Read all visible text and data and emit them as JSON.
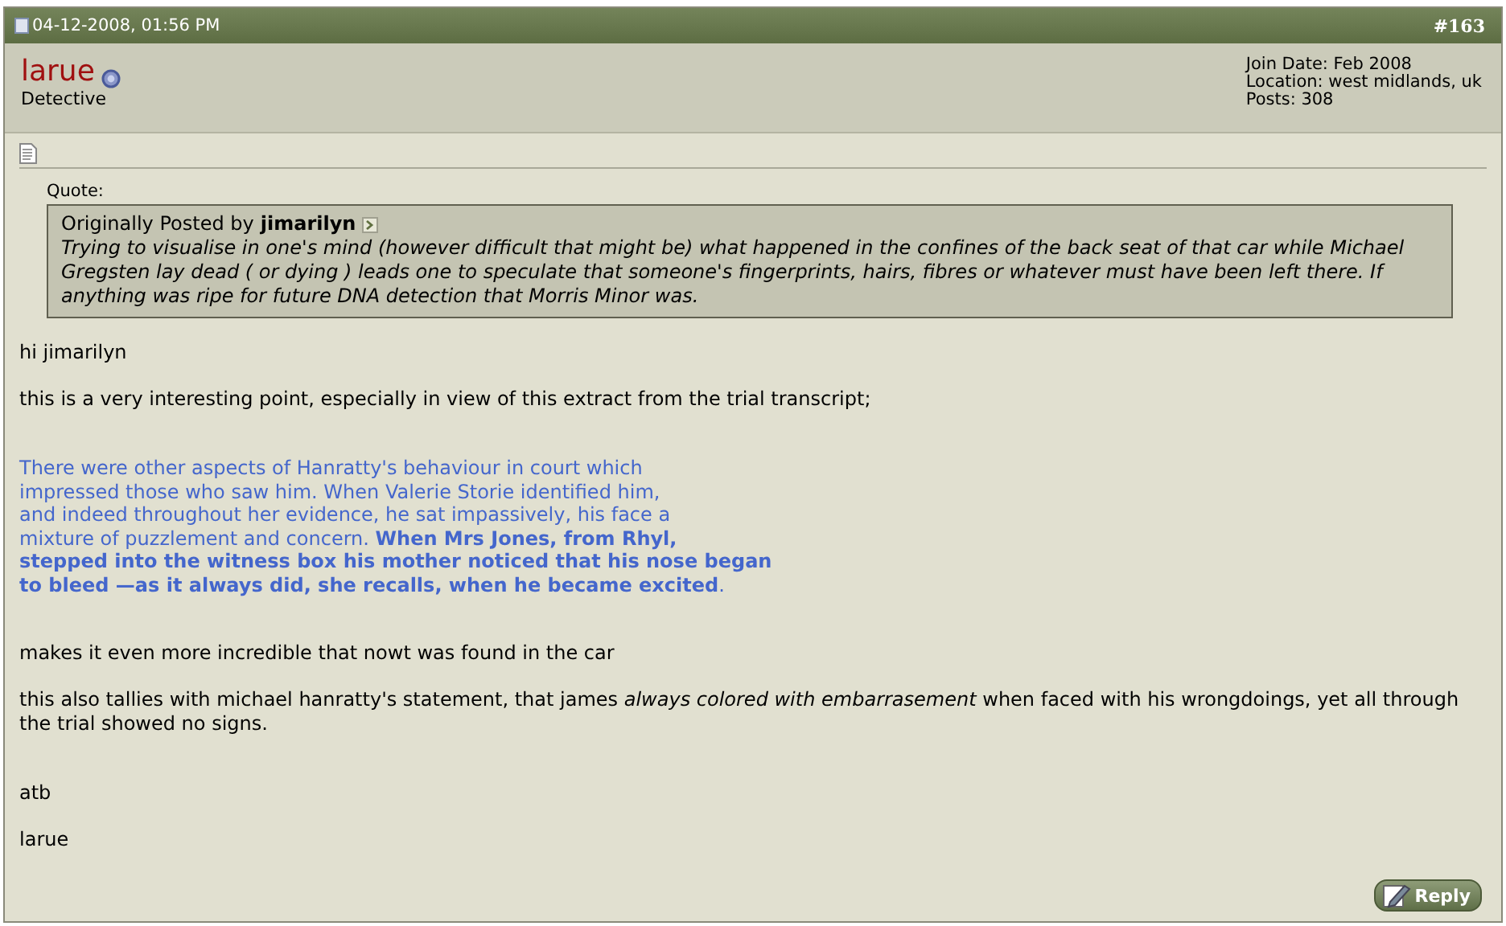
{
  "post_header": {
    "date": "04-12-2008, 01:56 PM",
    "number": "#163"
  },
  "user": {
    "name": "larue",
    "title": "Detective",
    "details": [
      "Join Date: Feb 2008",
      "Location: west midlands, uk",
      "Posts: 308"
    ]
  },
  "quote": {
    "label": "Quote:",
    "posted_by": "Originally Posted by",
    "author": "jimarilyn",
    "text": "Trying to visualise in one's mind (however difficult that might be) what happened in the confines of the back seat of that car while Michael Gregsten lay dead ( or dying ) leads one to speculate that someone's fingerprints, hairs, fibres or whatever must have been left there. If anything was ripe for future DNA detection that Morris Minor was."
  },
  "body": [
    {
      "kind": "text",
      "text": "hi jimarilyn"
    },
    {
      "kind": "text",
      "text": "this is a very interesting point, especially in view of this extract from the trial transcript;"
    },
    {
      "kind": "extract",
      "lines": [
        "There were other aspects of Hanratty's behaviour in court which",
        "impressed those who saw him. When Valerie Storie identified him,",
        "and indeed throughout her evidence, he sat impassively, his face a",
        "mixture of puzzlement and concern. **When Mrs Jones, from Rhyl,**",
        "**stepped into the witness box his mother noticed that his nose began**",
        "**to bleed —as it always did, she recalls, when he became excited**."
      ]
    },
    {
      "kind": "text",
      "text": "makes it even more incredible that nowt was found in the car"
    },
    {
      "kind": "text",
      "text": "this also tallies with michael hanratty's statement, that james *always colored with embarrasement* when faced with his wrongdoings, yet all through the trial showed no signs."
    },
    {
      "kind": "text",
      "text": "atb"
    },
    {
      "kind": "text",
      "text": "larue"
    }
  ],
  "reply_button": "Reply"
}
